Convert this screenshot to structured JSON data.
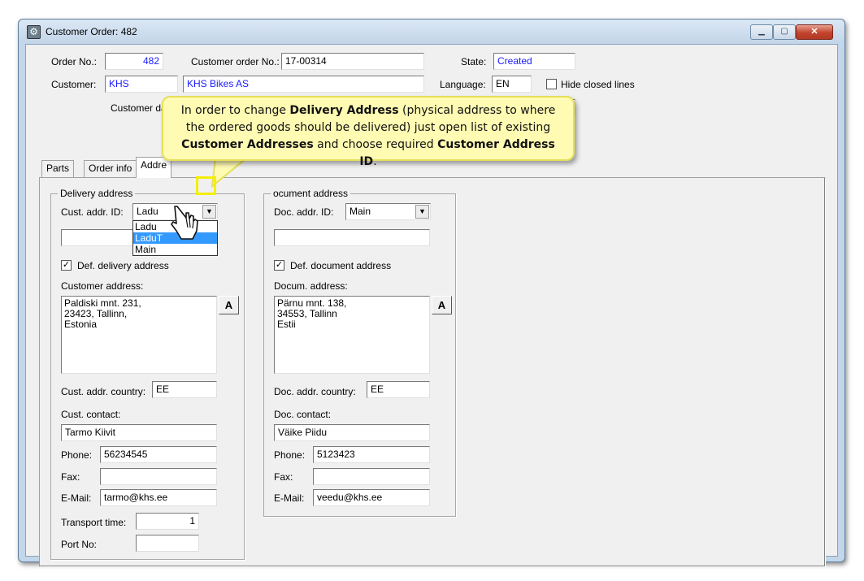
{
  "window": {
    "title": "Customer Order: 482",
    "minimize_glyph": "▁",
    "maximize_glyph": "▢",
    "close_glyph": "✕",
    "icon": "gear-icon"
  },
  "header": {
    "order_no_label": "Order No.:",
    "order_no_value": "482",
    "customer_order_no_label": "Customer order No.:",
    "customer_order_no_value": "17-00314",
    "state_label": "State:",
    "state_value": "Created",
    "customer_label": "Customer:",
    "customer_code": "KHS",
    "customer_name": "KHS Bikes AS",
    "language_label": "Language:",
    "language_value": "EN",
    "hide_closed_label": "Hide closed lines",
    "customer_da_label": "Customer da"
  },
  "tabs": [
    {
      "label": "Parts"
    },
    {
      "label": "Order info"
    },
    {
      "label": "Addre"
    }
  ],
  "delivery": {
    "group_title": "Delivery address",
    "cust_addr_id_label": "Cust. addr. ID:",
    "cust_addr_id_value": "Ladu",
    "dropdown_options": [
      "Ladu",
      "LaduT",
      "Main"
    ],
    "def_delivery_label": "Def. delivery address",
    "customer_address_label": "Customer address:",
    "customer_address_value": "Paldiski mnt. 231,\n23423, Tallinn,\nEstonia",
    "a_button": "A",
    "country_label": "Cust. addr. country:",
    "country_value": "EE",
    "contact_label": "Cust. contact:",
    "contact_value": "Tarmo Kiivit",
    "phone_label": "Phone:",
    "phone_value": "56234545",
    "fax_label": "Fax:",
    "fax_value": "",
    "email_label": "E-Mail:",
    "email_value": "tarmo@khs.ee",
    "transport_label": "Transport time:",
    "transport_value": "1",
    "port_label": "Port No:",
    "port_value": ""
  },
  "document": {
    "group_title": "ocument address",
    "doc_addr_id_label": "Doc. addr. ID:",
    "doc_addr_id_value": "Main",
    "def_document_label": "Def. document address",
    "docum_address_label": "Docum. address:",
    "docum_address_value": "Pärnu mnt. 138,\n34553, Tallinn\nEstii",
    "a_button": "A",
    "country_label": "Doc. addr. country:",
    "country_value": "EE",
    "contact_label": "Doc. contact:",
    "contact_value": "Väike Piidu",
    "phone_label": "Phone:",
    "phone_value": "5123423",
    "fax_label": "Fax:",
    "fax_value": "",
    "email_label": "E-Mail:",
    "email_value": "veedu@khs.ee"
  },
  "callout": {
    "p1": "In order to change ",
    "b1": "Delivery Address",
    "p2": " (physical address to where the ordered goods should be delivered) just open list of existing ",
    "b2": "Customer Addresses",
    "p3": " and choose required ",
    "b3": "Customer Address ID",
    "p4": "."
  },
  "colors": {
    "accent_blue": "#1a1aff",
    "selection": "#3399ff",
    "callout_bg": "#fffbb3",
    "highlight": "#f4ee00"
  }
}
